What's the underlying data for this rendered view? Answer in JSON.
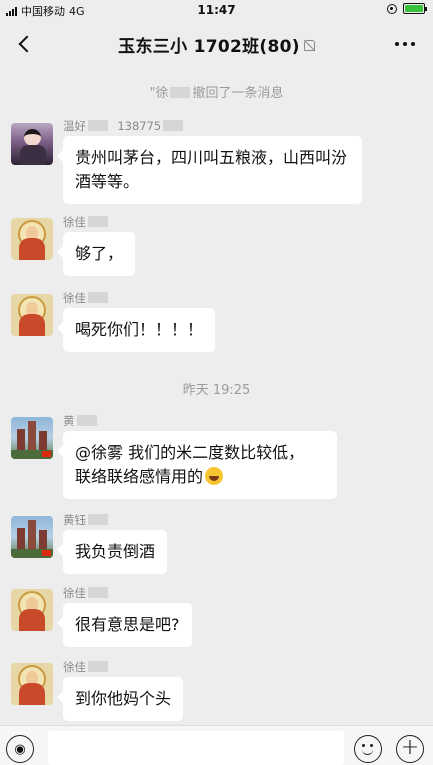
{
  "status_bar": {
    "carrier": "中国移动",
    "network": "4G",
    "time": "11:47"
  },
  "header": {
    "title": "玉东三小 1702班(80)"
  },
  "system": {
    "recall_prefix": "\"徐",
    "recall_suffix": "撤回了一条消息",
    "timestamp": "昨天 19:25"
  },
  "messages": [
    {
      "sender": "温好",
      "sender_extra": "138775",
      "text": "贵州叫茅台，四川叫五粮液，山西叫汾酒等等。"
    },
    {
      "sender": "徐佳",
      "text": "够了，"
    },
    {
      "sender": "徐佳",
      "text": "喝死你们！！！！"
    },
    {
      "sender": "黄",
      "text_line1": "@徐雾 我们的米二度数比较低，",
      "text_line2": "联络联络感情用的"
    },
    {
      "sender": "黄钰",
      "text": "我负责倒酒"
    },
    {
      "sender": "徐佳",
      "text": "很有意思是吧?"
    },
    {
      "sender": "徐佳",
      "text": "到你他妈个头"
    }
  ]
}
